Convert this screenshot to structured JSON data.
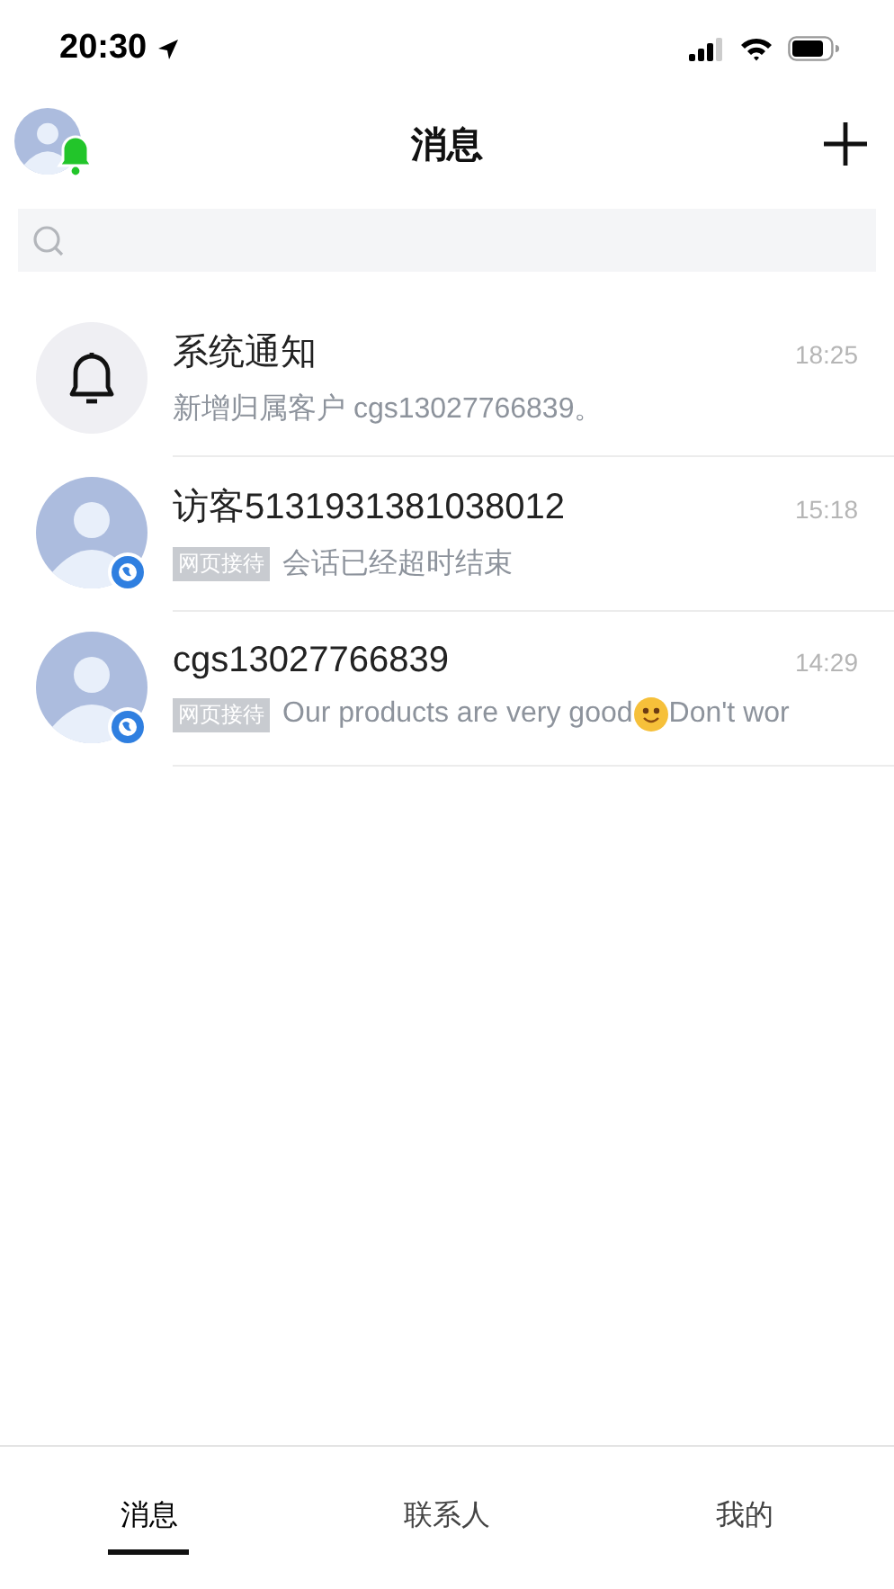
{
  "status_bar": {
    "time": "20:30"
  },
  "header": {
    "title": "消息"
  },
  "conversations": [
    {
      "kind": "system",
      "name": "系统通知",
      "time": "18:25",
      "segments": [
        {
          "kind": "text",
          "text": "新增归属客户 cgs13027766839。"
        }
      ]
    },
    {
      "kind": "visitor",
      "name": "访客5131931381038012",
      "time": "15:18",
      "tag": "网页接待",
      "segments": [
        {
          "kind": "text",
          "text": "会话已经超时结束"
        }
      ]
    },
    {
      "kind": "visitor",
      "name": "cgs13027766839",
      "time": "14:29",
      "tag": "网页接待",
      "segments": [
        {
          "kind": "text",
          "text": "Our products are very good"
        },
        {
          "kind": "smiley"
        },
        {
          "kind": "text",
          "text": "Don't wor"
        }
      ]
    }
  ],
  "tabs": [
    {
      "label": "消息",
      "selected": true
    },
    {
      "label": "联系人",
      "selected": false
    },
    {
      "label": "我的",
      "selected": false
    }
  ]
}
